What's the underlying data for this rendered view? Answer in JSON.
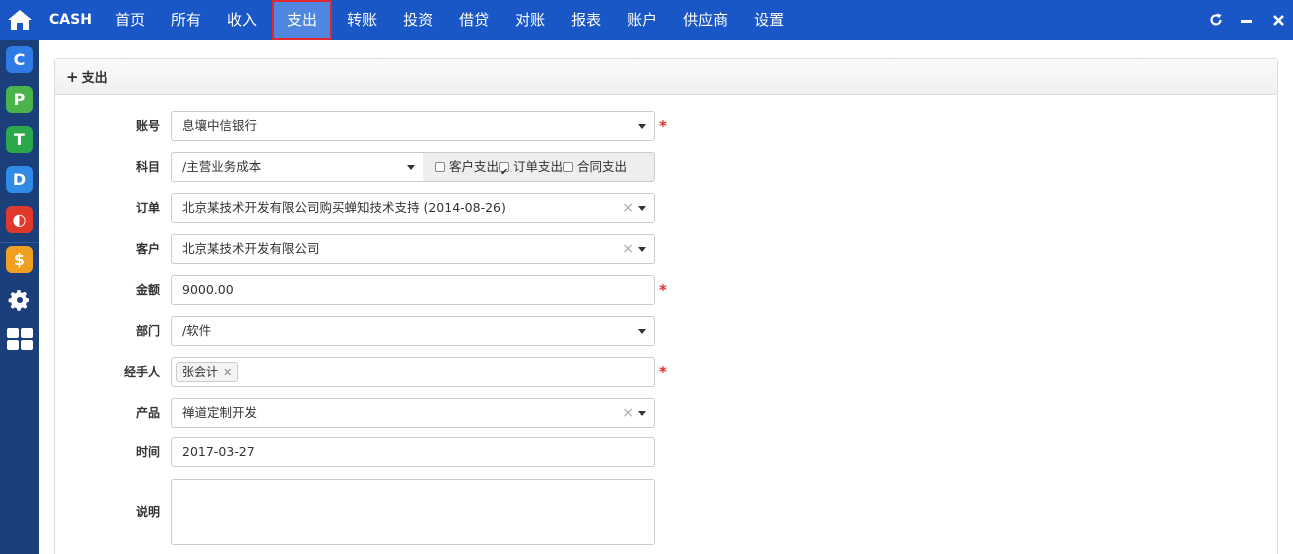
{
  "app": {
    "brand": "CASH"
  },
  "nav": [
    {
      "label": "首页",
      "active": false
    },
    {
      "label": "所有",
      "active": false
    },
    {
      "label": "收入",
      "active": false
    },
    {
      "label": "支出",
      "active": true
    },
    {
      "label": "转账",
      "active": false
    },
    {
      "label": "投资",
      "active": false
    },
    {
      "label": "借贷",
      "active": false
    },
    {
      "label": "对账",
      "active": false
    },
    {
      "label": "报表",
      "active": false
    },
    {
      "label": "账户",
      "active": false
    },
    {
      "label": "供应商",
      "active": false
    },
    {
      "label": "设置",
      "active": false
    }
  ],
  "dock": {
    "apps": [
      {
        "letter": "C",
        "color": "#2f7be6"
      },
      {
        "letter": "P",
        "color": "#4ab34a"
      },
      {
        "letter": "T",
        "color": "#2ba84a"
      },
      {
        "letter": "D",
        "color": "#2f8be6"
      },
      {
        "letter": "◐",
        "color": "#e0392b"
      },
      {
        "letter": "$",
        "color": "#f0a020"
      }
    ],
    "tools": [
      "gear-icon",
      "grid-icon"
    ]
  },
  "window_controls": [
    "refresh-icon",
    "minimize-icon",
    "close-icon"
  ],
  "panel": {
    "title": "支出"
  },
  "form": {
    "account": {
      "label": "账号",
      "value": "息壤中信银行",
      "required_mark": "*"
    },
    "category": {
      "label": "科目",
      "value": "/主营业务成本",
      "options": {
        "customer": "客户支出",
        "order": "订单支出",
        "contract": "合同支出"
      },
      "order_checked": true
    },
    "order": {
      "label": "订单",
      "value": "北京某技术开发有限公司购买蝉知技术支持 (2014-08-26)"
    },
    "customer": {
      "label": "客户",
      "value": "北京某技术开发有限公司"
    },
    "amount": {
      "label": "金额",
      "value": "9000.00",
      "required_mark": "*"
    },
    "department": {
      "label": "部门",
      "value": "/软件"
    },
    "handler": {
      "label": "经手人",
      "tag": "张会计",
      "required_mark": "*"
    },
    "product": {
      "label": "产品",
      "value": "禅道定制开发"
    },
    "date": {
      "label": "时间",
      "value": "2017-03-27"
    },
    "desc": {
      "label": "说明",
      "value": ""
    }
  }
}
